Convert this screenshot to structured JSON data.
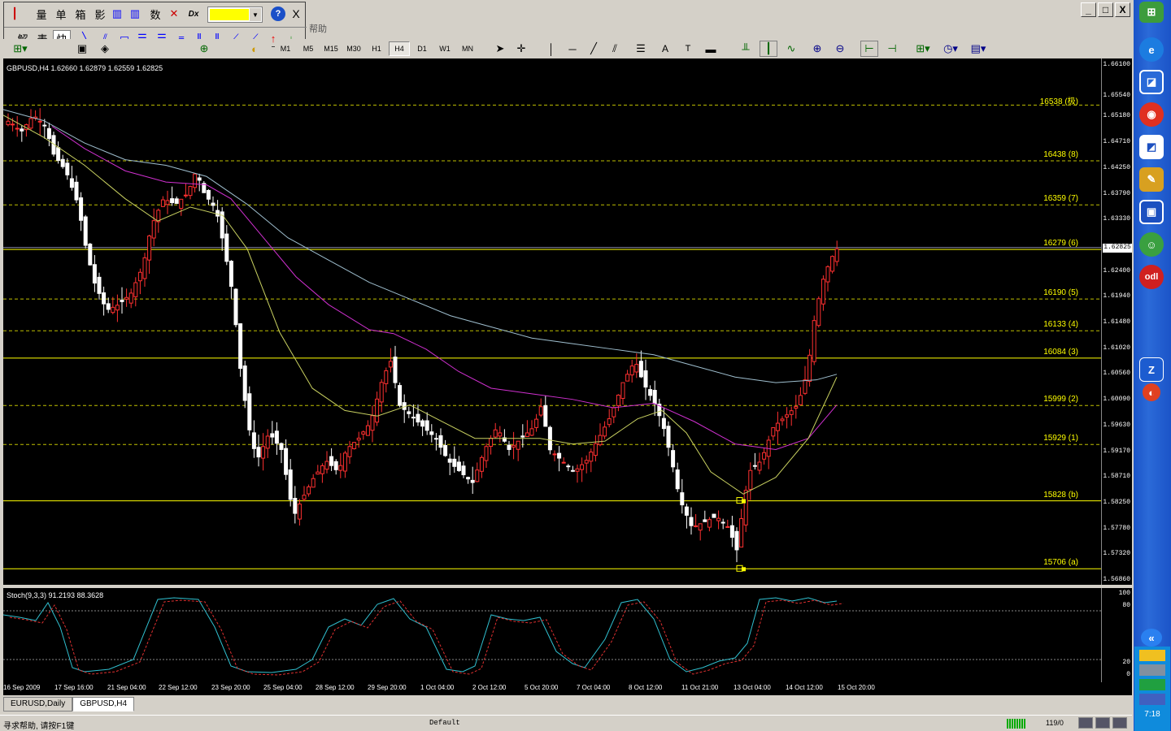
{
  "window": {
    "minimize": "_",
    "maximize": "□",
    "close": "X"
  },
  "input_toolbar": {
    "buttons": [
      "量",
      "单",
      "箱",
      "影",
      "数"
    ],
    "color_value": "",
    "help": "?",
    "close": "X",
    "row2": [
      "解",
      "表",
      "快"
    ]
  },
  "menu": {
    "help_text": "帮助"
  },
  "timeframes": [
    "M1",
    "M5",
    "M15",
    "M30",
    "H1",
    "H4",
    "D1",
    "W1",
    "MN"
  ],
  "timeframe_active": "H4",
  "chart": {
    "symbol_info": "GBPUSD,H4  1.62660 1.62879 1.62559 1.62825",
    "current_price": "1.62825",
    "price_labels": [
      "1.66100",
      "1.65540",
      "1.65180",
      "1.64710",
      "1.64250",
      "1.63790",
      "1.63330",
      "1.62400",
      "1.61940",
      "1.61480",
      "1.61020",
      "1.60560",
      "1.60090",
      "1.59630",
      "1.59170",
      "1.58710",
      "1.58250",
      "1.57780",
      "1.57320",
      "1.56860"
    ],
    "levels": [
      {
        "label": "16538 (极)",
        "price": 1.6538,
        "color": "#c0c000"
      },
      {
        "label": "16438 (8)",
        "price": 1.6438,
        "color": "#c0c000"
      },
      {
        "label": "16359 (7)",
        "price": 1.6359,
        "color": "#c0c000"
      },
      {
        "label": "16279 (6)",
        "price": 1.6279,
        "color": "#ffff00"
      },
      {
        "label": "16190 (5)",
        "price": 1.619,
        "color": "#c0c000"
      },
      {
        "label": "16133 (4)",
        "price": 1.6133,
        "color": "#c0c000"
      },
      {
        "label": "16084 (3)",
        "price": 1.6084,
        "color": "#ffff00"
      },
      {
        "label": "15999 (2)",
        "price": 1.5999,
        "color": "#c0c000"
      },
      {
        "label": "15929 (1)",
        "price": 1.5929,
        "color": "#c0c000"
      },
      {
        "label": "15828 (b)",
        "price": 1.5828,
        "color": "#ffff00"
      },
      {
        "label": "15706 (a)",
        "price": 1.5706,
        "color": "#ffff00"
      }
    ]
  },
  "indicator": {
    "title": "Stoch(9,3,3) 91.2193 88.3628",
    "levels": [
      "100",
      "80",
      "20",
      "0"
    ]
  },
  "xaxis": [
    "16 Sep 2009",
    "17 Sep 16:00",
    "21 Sep 04:00",
    "22 Sep 12:00",
    "23 Sep 20:00",
    "25 Sep 04:00",
    "28 Sep 12:00",
    "29 Sep 20:00",
    "1 Oct 04:00",
    "2 Oct 12:00",
    "5 Oct 20:00",
    "7 Oct 04:00",
    "8 Oct 12:00",
    "11 Oct 21:00",
    "13 Oct 04:00",
    "14 Oct 12:00",
    "15 Oct 20:00"
  ],
  "tabs": [
    "EURUSD,Daily",
    "GBPUSD,H4"
  ],
  "status": {
    "help": "寻求帮助, 请按F1键",
    "profile": "Default",
    "conn": "119/0"
  },
  "clock": "7:18"
}
